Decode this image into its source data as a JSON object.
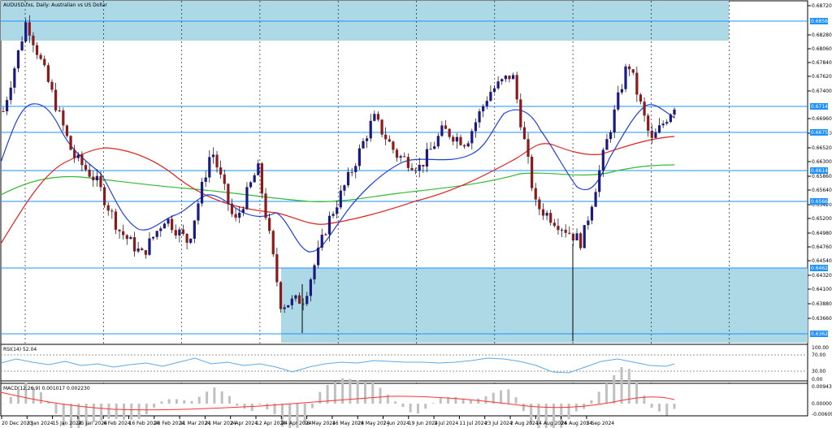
{
  "title": "AUDUSD.fxs, Daily:  Australian vs US Dollar",
  "colors": {
    "background": "#ffffff",
    "zone": "#add8e6",
    "level_line": "#1e90ff",
    "level_tag": "#1e90ff",
    "bull": "#1a1a80",
    "bear": "#8b1a1a",
    "ma_fast": "#1f3fd6",
    "ma_mid": "#e0211f",
    "ma_slow": "#33bb33",
    "grid": "#000000",
    "rsi": "#5ea9e8",
    "macd_hist": "#c0c0c0",
    "macd_signal": "#ff3030"
  },
  "price_axis": {
    "ticks": [
      "0.68720",
      "0.68280",
      "0.68060",
      "0.67840",
      "0.67620",
      "0.67400",
      "0.66960",
      "0.66740",
      "0.66520",
      "0.66300",
      "0.65860",
      "0.65640",
      "0.65420",
      "0.65200",
      "0.64980",
      "0.64760",
      "0.64540",
      "0.64320",
      "0.64100",
      "0.63880",
      "0.63660"
    ],
    "levels": [
      {
        "name": "top-resistance",
        "label": "0.68561"
      },
      {
        "name": "level-67148",
        "label": "0.67148"
      },
      {
        "name": "level-66751",
        "label": "0.66751"
      },
      {
        "name": "level-66140",
        "label": "0.66140"
      },
      {
        "name": "level-65668",
        "label": "0.65668"
      },
      {
        "name": "level-64625",
        "label": "0.64625"
      },
      {
        "name": "level-63629",
        "label": "0.63629"
      }
    ]
  },
  "time_axis": [
    "20 Dec 2023",
    "3 Jan 2024",
    "15 Jan 2024",
    "25 Jan 2024",
    "6 Feb 2024",
    "16 Feb 2024",
    "28 Feb 2024",
    "11 Mar 2024",
    "21 Mar 2024",
    "2 Apr 2024",
    "12 Apr 2024",
    "24 Apr 2024",
    "6 May 2024",
    "16 May 2024",
    "28 May 2024",
    "7 Jun 2024",
    "19 Jun 2024",
    "1 Jul 2024",
    "11 Jul 2024",
    "23 Jul 2024",
    "2 Aug 2024",
    "14 Aug 2024",
    "26 Aug 2024",
    "5 Sep 2024"
  ],
  "rsi": {
    "label": "RSI(14) 52.04",
    "ticks": [
      "100.00",
      "70.00",
      "30.00",
      "0.00"
    ]
  },
  "macd": {
    "label": "MACD(12,26,9) 0.001017 0.002230",
    "ticks": [
      "0.009439",
      "0.000000",
      "-0.006092"
    ]
  },
  "chart_data": {
    "type": "candlestick",
    "title": "AUDUSD.fxs, Daily:  Australian vs US Dollar",
    "x_range": [
      "20 Dec 2023",
      "13 Sep 2024"
    ],
    "y_range": [
      0.6355,
      0.6875
    ],
    "indicators": [
      "RSI(14) 52.04",
      "MACD(12,26,9) 0.001017 0.002230"
    ],
    "close_path": [
      {
        "x": "20 Dec 2023",
        "y": 0.671
      },
      {
        "x": "28 Dec 2023",
        "y": 0.6855
      },
      {
        "x": "3 Jan 2024",
        "y": 0.675
      },
      {
        "x": "15 Jan 2024",
        "y": 0.664
      },
      {
        "x": "25 Jan 2024",
        "y": 0.66
      },
      {
        "x": "6 Feb 2024",
        "y": 0.652
      },
      {
        "x": "13 Feb 2024",
        "y": 0.648
      },
      {
        "x": "16 Feb 2024",
        "y": 0.654
      },
      {
        "x": "28 Feb 2024",
        "y": 0.65
      },
      {
        "x": "8 Mar 2024",
        "y": 0.665
      },
      {
        "x": "21 Mar 2024",
        "y": 0.653
      },
      {
        "x": "2 Apr 2024",
        "y": 0.662
      },
      {
        "x": "12 Apr 2024",
        "y": 0.64
      },
      {
        "x": "19 Apr 2024",
        "y": 0.641
      },
      {
        "x": "24 Apr 2024",
        "y": 0.653
      },
      {
        "x": "6 May 2024",
        "y": 0.661
      },
      {
        "x": "16 May 2024",
        "y": 0.67
      },
      {
        "x": "28 May 2024",
        "y": 0.664
      },
      {
        "x": "7 Jun 2024",
        "y": 0.662
      },
      {
        "x": "19 Jun 2024",
        "y": 0.668
      },
      {
        "x": "1 Jul 2024",
        "y": 0.666
      },
      {
        "x": "8 Jul 2024",
        "y": 0.674
      },
      {
        "x": "11 Jul 2024",
        "y": 0.677
      },
      {
        "x": "23 Jul 2024",
        "y": 0.656
      },
      {
        "x": "2 Aug 2024",
        "y": 0.653
      },
      {
        "x": "5 Aug 2024",
        "y": 0.65
      },
      {
        "x": "14 Aug 2024",
        "y": 0.665
      },
      {
        "x": "26 Aug 2024",
        "y": 0.679
      },
      {
        "x": "5 Sep 2024",
        "y": 0.666
      },
      {
        "x": "13 Sep 2024",
        "y": 0.672
      }
    ]
  }
}
